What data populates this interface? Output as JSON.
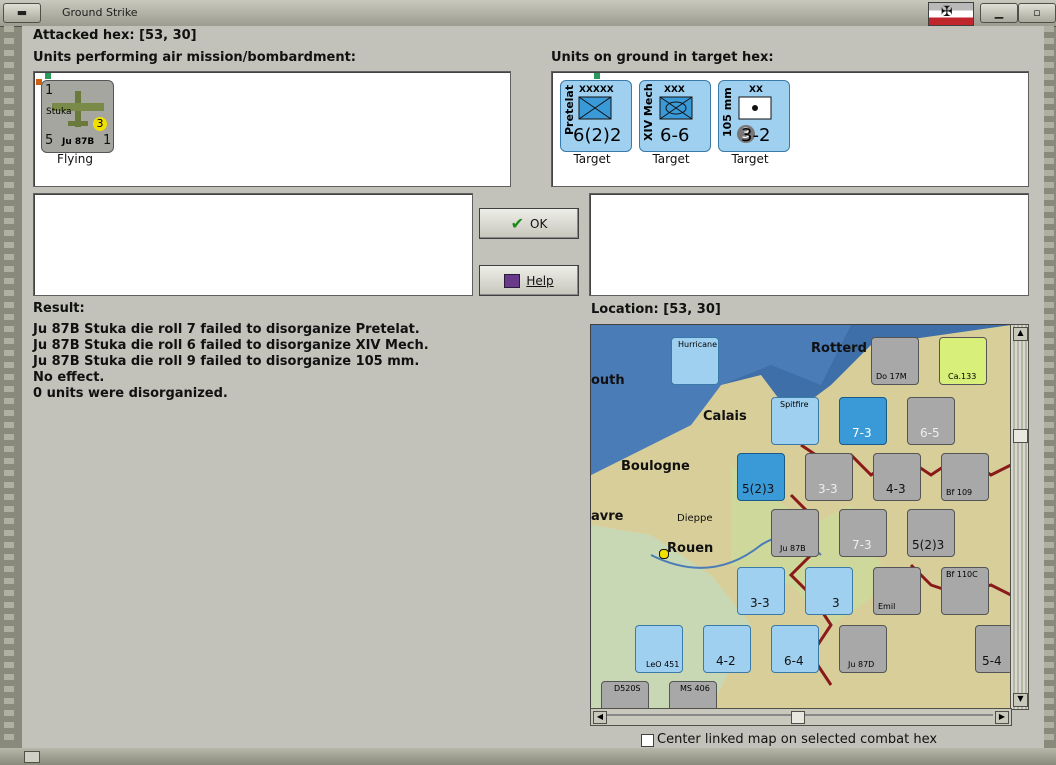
{
  "window": {
    "title": "Ground Strike",
    "minimize_icon": "minimize-icon",
    "close_icon": "close-icon"
  },
  "attacked_hex": "Attacked hex:  [53, 30]",
  "air_units_heading": "Units performing air mission/bombardment:",
  "ground_units_heading": "Units on ground in target hex:",
  "air_units": [
    {
      "strength_top": "1",
      "name": "Stuka",
      "badge": "3",
      "left_val": "5",
      "type": "Ju 87B",
      "right_val": "1",
      "status": "Flying"
    }
  ],
  "ground_units": [
    {
      "name": "Pretelat",
      "size": "XXXXX",
      "strength": "6(2)2",
      "status": "Target"
    },
    {
      "name": "XIV Mech",
      "size": "XXX",
      "strength": "6-6",
      "status": "Target"
    },
    {
      "name": "105 mm",
      "size": "XX",
      "strength": "3-2",
      "badge": "3",
      "status": "Target"
    }
  ],
  "buttons": {
    "ok": "OK",
    "help": "Help"
  },
  "result": {
    "heading": "Result:",
    "lines": [
      "Ju 87B Stuka die roll 7 failed to disorganize Pretelat.",
      "Ju 87B Stuka die roll 6 failed to disorganize XIV Mech.",
      "Ju 87B Stuka die roll 9 failed to disorganize 105 mm.",
      "No effect.",
      "0 units were disorganized."
    ]
  },
  "location": "Location:  [53, 30]",
  "map": {
    "places": [
      "Rotterd",
      "outh",
      "Calais",
      "Boulogne",
      "avre",
      "Dieppe",
      "Rouen"
    ],
    "counter_strengths": [
      "7-3",
      "6-5",
      "5(2)3",
      "3-3",
      "4-3",
      "7-3",
      "5(2)3",
      "3-3",
      "3",
      "4-2",
      "6-4",
      "5-4"
    ],
    "air_labels": [
      "Hurricane",
      "Spitfire",
      "Do 17M",
      "Ca.133",
      "Ju 87B",
      "Bf 109",
      "Bf 110C",
      "LeO 451",
      "Ju 87D",
      "D520S",
      "MS 406",
      "Emil"
    ]
  },
  "center_checkbox_label": "Center linked map on selected combat hex",
  "colors": {
    "ally_counter": "#9fd0f0",
    "axis_counter": "#a8a8a8",
    "panel": "#c2c2ba"
  }
}
